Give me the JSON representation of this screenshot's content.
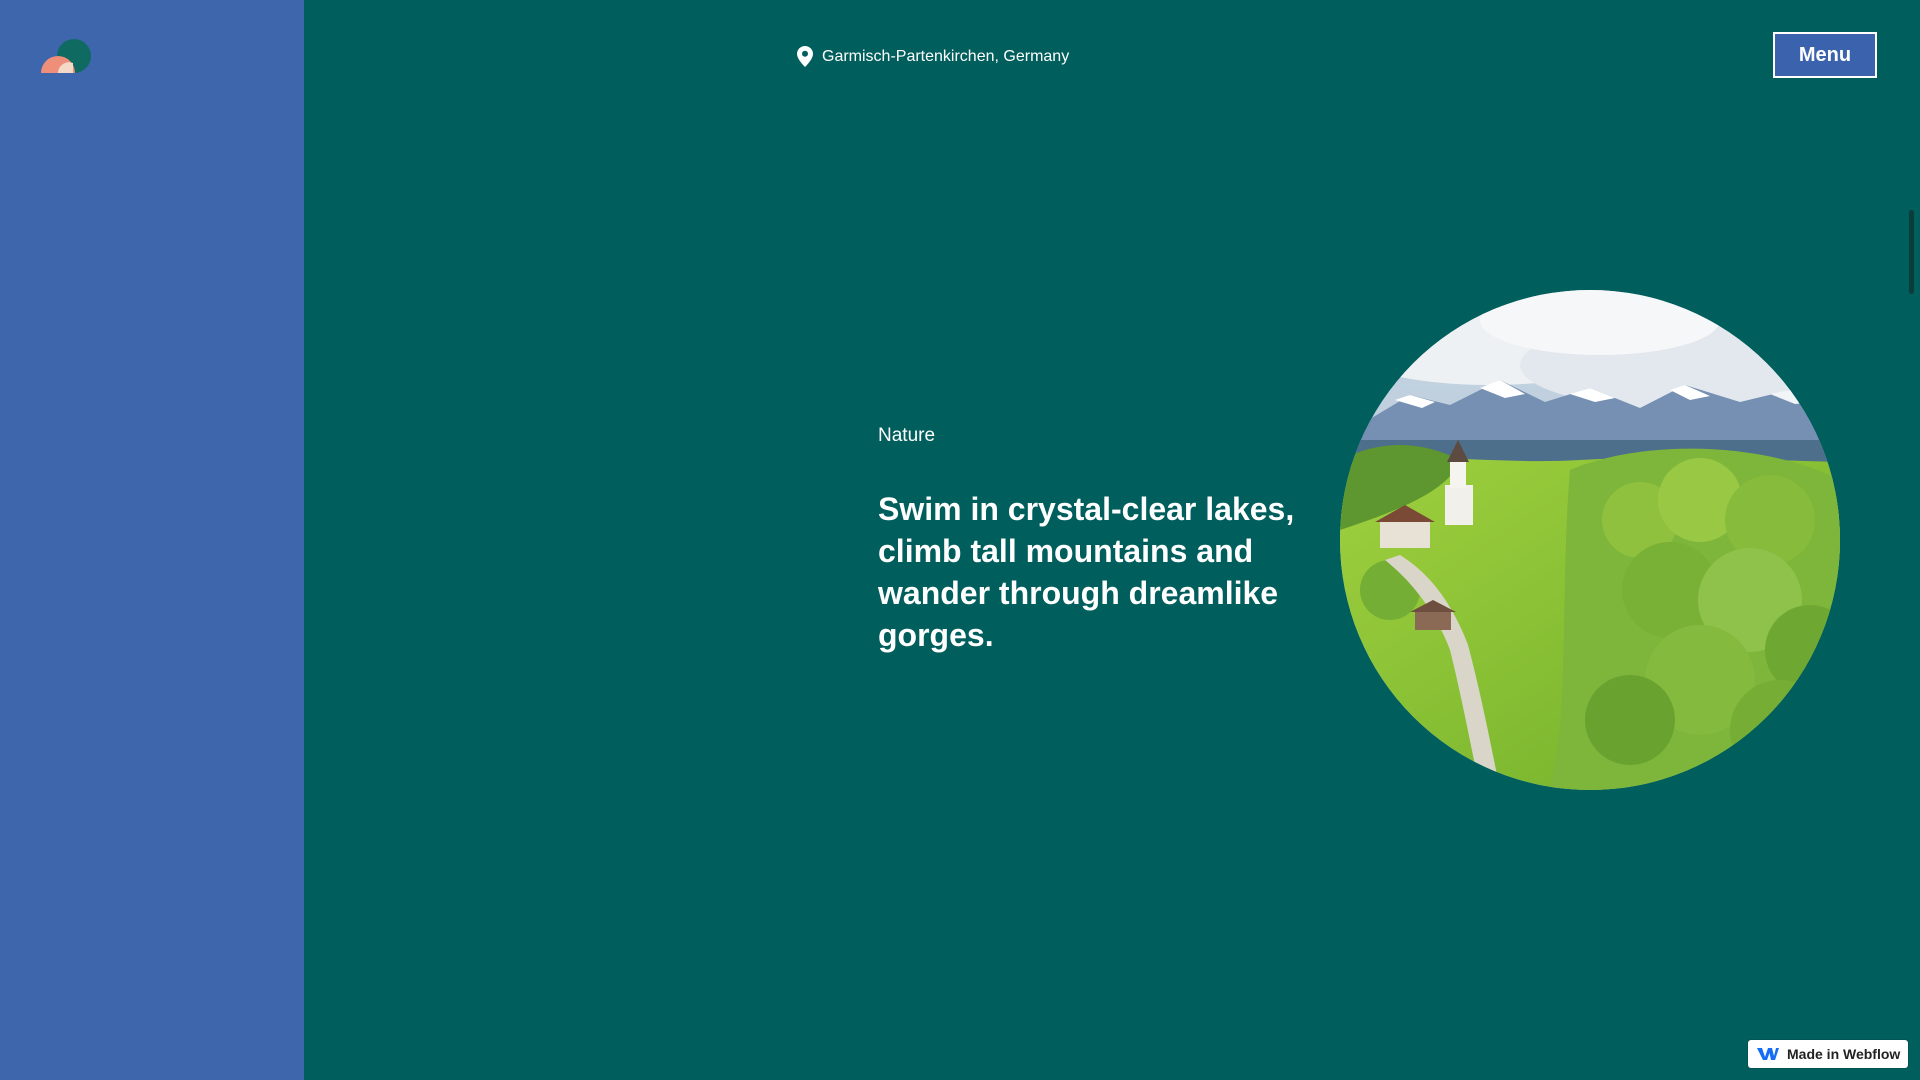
{
  "colors": {
    "background": "#005e5c",
    "sidebar": "#3d66ad",
    "menu_button": "#3b62ac",
    "text": "#ffffff"
  },
  "header": {
    "logo_icon": "half-circles-logo-icon",
    "location_icon": "map-pin-icon",
    "location": "Garmisch-Partenkirchen, Germany",
    "menu_label": "Menu"
  },
  "hero": {
    "category": "Nature",
    "headline": "Swim in crystal-clear lakes, climb tall mountains and wander through dreamlike gorges."
  },
  "badge": {
    "icon": "webflow-icon",
    "label": "Made in Webflow"
  }
}
